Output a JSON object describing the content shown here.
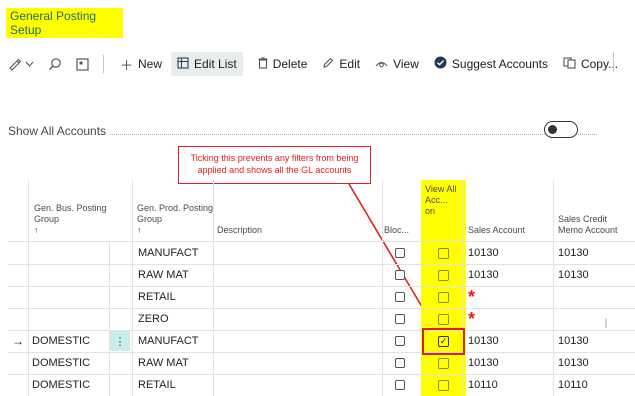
{
  "page": {
    "title": "General Posting Setup"
  },
  "toolbar": {
    "new_label": "New",
    "edit_list_label": "Edit List",
    "delete_label": "Delete",
    "edit_label": "Edit",
    "view_label": "View",
    "suggest_label": "Suggest Accounts",
    "copy_label": "Copy..."
  },
  "filter": {
    "show_all_label": "Show All Accounts",
    "show_all_value": false
  },
  "callout": {
    "text": "Ticking this prevents any filters from being applied and shows all the GL accounts"
  },
  "columns": {
    "gen_bus": "Gen. Bus. Posting Group",
    "gen_bus_sort": "↑",
    "gen_prod": "Gen. Prod. Posting Group",
    "gen_prod_sort": "↑",
    "description": "Description",
    "blocked": "Bloc...",
    "view_all": "View All Acc... on",
    "sales_account": "Sales Account",
    "sales_credit": "Sales Credit Memo Account"
  },
  "rows": [
    {
      "marker": "",
      "bus": "",
      "prod": "MANUFACT",
      "desc": "",
      "blocked": false,
      "view_all": false,
      "sales": "10130",
      "credit": "10130"
    },
    {
      "marker": "",
      "bus": "",
      "prod": "RAW MAT",
      "desc": "",
      "blocked": false,
      "view_all": false,
      "sales": "10130",
      "credit": "10130"
    },
    {
      "marker": "",
      "bus": "",
      "prod": "RETAIL",
      "desc": "",
      "blocked": false,
      "view_all": false,
      "sales": "*",
      "credit": ""
    },
    {
      "marker": "",
      "bus": "",
      "prod": "ZERO",
      "desc": "",
      "blocked": false,
      "view_all": false,
      "sales": "*",
      "credit": ""
    },
    {
      "marker": "→",
      "bus": "DOMESTIC",
      "prod": "MANUFACT",
      "desc": "",
      "blocked": false,
      "view_all": true,
      "sales": "10130",
      "credit": "10130"
    },
    {
      "marker": "",
      "bus": "DOMESTIC",
      "prod": "RAW MAT",
      "desc": "",
      "blocked": false,
      "view_all": false,
      "sales": "10130",
      "credit": "10130"
    },
    {
      "marker": "",
      "bus": "DOMESTIC",
      "prod": "RETAIL",
      "desc": "",
      "blocked": false,
      "view_all": false,
      "sales": "10110",
      "credit": "10110"
    }
  ],
  "colors": {
    "highlight": "#ffff00",
    "annotation": "#e02020",
    "title": "#1b6f6f"
  }
}
